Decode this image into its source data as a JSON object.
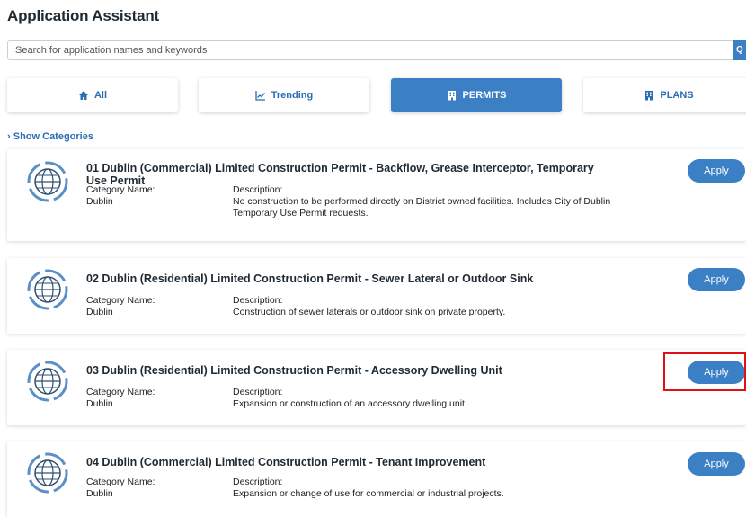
{
  "page": {
    "title": "Application Assistant"
  },
  "search": {
    "placeholder": "Search for application names and keywords",
    "button_label": "Q"
  },
  "tabs": [
    {
      "label": "All",
      "icon": "home-icon",
      "active": false
    },
    {
      "label": "Trending",
      "icon": "trending-chart-icon",
      "active": false
    },
    {
      "label": "PERMITS",
      "icon": "building-icon",
      "active": true
    },
    {
      "label": "PLANS",
      "icon": "building-icon",
      "active": false
    }
  ],
  "show_categories": {
    "label": "Show Categories"
  },
  "cards": [
    {
      "title": "01 Dublin (Commercial) Limited Construction Permit - Backflow, Grease Interceptor, Temporary Use Permit",
      "category_label": "Category Name:",
      "category_value": "Dublin",
      "description_label": "Description:",
      "description_value": "No construction to be performed directly on District owned facilities. Includes City of Dublin Temporary Use Permit requests.",
      "apply_label": "Apply"
    },
    {
      "title": "02 Dublin (Residential) Limited Construction Permit - Sewer Lateral or Outdoor Sink",
      "category_label": "Category Name:",
      "category_value": "Dublin",
      "description_label": "Description:",
      "description_value": "Construction of sewer laterals or outdoor sink on private property.",
      "apply_label": "Apply"
    },
    {
      "title": "03 Dublin (Residential) Limited Construction Permit - Accessory Dwelling Unit",
      "category_label": "Category Name:",
      "category_value": "Dublin",
      "description_label": "Description:",
      "description_value": "Expansion or construction of an accessory dwelling unit.",
      "apply_label": "Apply"
    },
    {
      "title": "04 Dublin (Commercial) Limited Construction Permit - Tenant Improvement",
      "category_label": "Category Name:",
      "category_value": "Dublin",
      "description_label": "Description:",
      "description_value": "Expansion or change of use for commercial or industrial projects.",
      "apply_label": "Apply"
    }
  ],
  "colors": {
    "accent": "#3b7fc4",
    "link": "#2a6db3",
    "highlight_box": "#e0101a"
  }
}
